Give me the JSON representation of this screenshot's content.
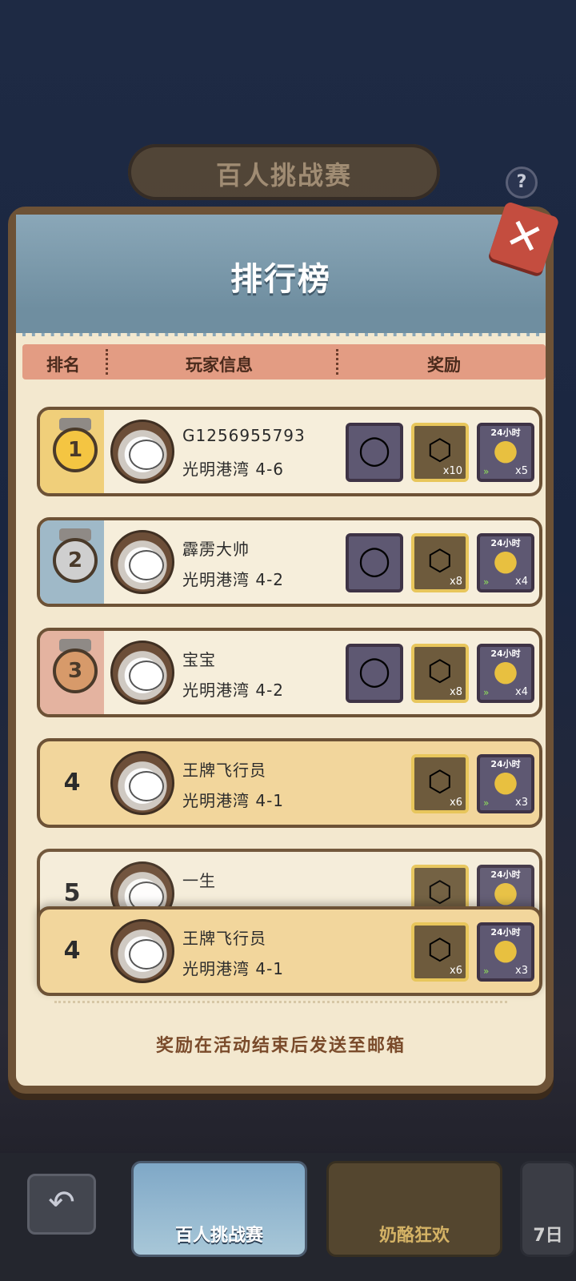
{
  "banner": {
    "title": "百人挑战赛"
  },
  "help": {
    "label": "?"
  },
  "panel": {
    "title": "排行榜",
    "close_label": "✕",
    "columns": {
      "rank": "排名",
      "player": "玩家信息",
      "reward": "奖励"
    },
    "rows": [
      {
        "rank": "1",
        "name": "G1256955793",
        "level": "光明港湾 4-6",
        "rewards": [
          {
            "type": "frame",
            "qty": ""
          },
          {
            "type": "cube",
            "qty": "x10"
          },
          {
            "type": "coin",
            "tag": "24小时",
            "qty": "x5"
          }
        ]
      },
      {
        "rank": "2",
        "name": "霹雳大帅",
        "level": "光明港湾 4-2",
        "rewards": [
          {
            "type": "frame",
            "qty": ""
          },
          {
            "type": "cube",
            "qty": "x8"
          },
          {
            "type": "coin",
            "tag": "24小时",
            "qty": "x4"
          }
        ]
      },
      {
        "rank": "3",
        "name": "宝宝",
        "level": "光明港湾 4-2",
        "rewards": [
          {
            "type": "frame",
            "qty": ""
          },
          {
            "type": "cube",
            "qty": "x8"
          },
          {
            "type": "coin",
            "tag": "24小时",
            "qty": "x4"
          }
        ]
      },
      {
        "rank": "4",
        "name": "王牌飞行员",
        "level": "光明港湾 4-1",
        "rewards": [
          {
            "type": "cube",
            "qty": "x6"
          },
          {
            "type": "coin",
            "tag": "24小时",
            "qty": "x3"
          }
        ]
      },
      {
        "rank": "5",
        "name": "一生",
        "level": "",
        "rewards": [
          {
            "type": "cube",
            "qty": ""
          },
          {
            "type": "coin",
            "tag": "24小时",
            "qty": ""
          }
        ]
      }
    ],
    "my_row": {
      "rank": "4",
      "name": "王牌飞行员",
      "level": "光明港湾 4-1",
      "rewards": [
        {
          "type": "cube",
          "qty": "x6"
        },
        {
          "type": "coin",
          "tag": "24小时",
          "qty": "x3"
        }
      ]
    },
    "footer": "奖励在活动结束后发送至邮箱"
  },
  "bottom": {
    "back_label": "↶",
    "tabs": [
      {
        "label": "百人挑战赛"
      },
      {
        "label": "奶酪狂欢"
      },
      {
        "label": "7日"
      }
    ]
  }
}
